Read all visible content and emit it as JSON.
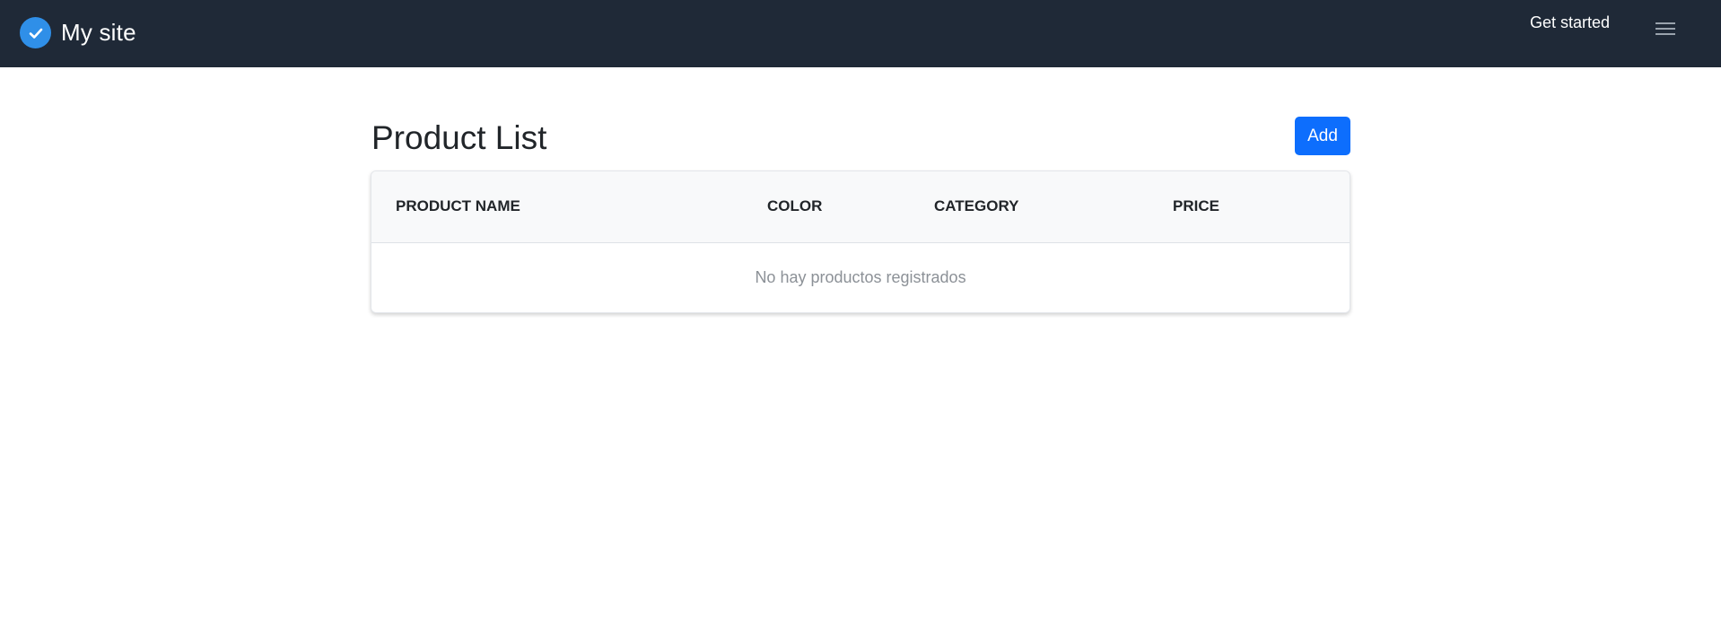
{
  "navbar": {
    "brand_name": "My site",
    "links": [
      {
        "label": "Get started"
      }
    ]
  },
  "page": {
    "title": "Product List",
    "add_label": "Add"
  },
  "table": {
    "columns": [
      "PRODUCT NAME",
      "COLOR",
      "CATEGORY",
      "PRICE"
    ],
    "empty_message": "No hay productos registrados"
  },
  "colors": {
    "navbar_bg": "#1f2937",
    "brand_icon": "#2f8fe8",
    "primary": "#0d6efd"
  },
  "icons": {
    "brand": "check-circle-icon",
    "menu": "hamburger-menu-icon"
  }
}
